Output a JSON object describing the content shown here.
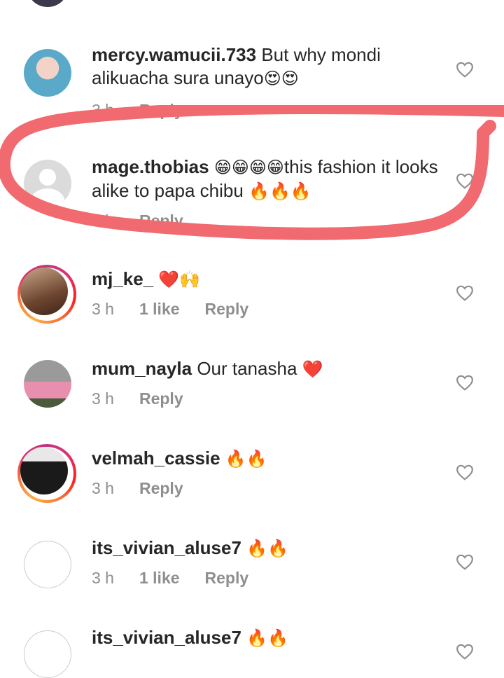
{
  "comments": [
    {
      "username": "mercy.wamucii.733",
      "text": "But why mondi alikuacha sura unayo",
      "emojis": "😍😍",
      "time": "3 h",
      "likes": "",
      "reply": "Reply"
    },
    {
      "username": "mage.thobias",
      "text_prefix": "😁😁😁😁",
      "text": "this fashion it looks alike to papa chibu",
      "emojis": "🔥🔥🔥",
      "time": "3 h",
      "likes": "",
      "reply": "Reply"
    },
    {
      "username": "mj_ke_",
      "text": "",
      "emojis": "❤️🙌",
      "time": "3 h",
      "likes": "1 like",
      "reply": "Reply"
    },
    {
      "username": "mum_nayla",
      "text": "Our tanasha",
      "emojis": "❤️",
      "time": "3 h",
      "likes": "",
      "reply": "Reply"
    },
    {
      "username": "velmah_cassie",
      "text": "",
      "emojis": "🔥🔥",
      "time": "3 h",
      "likes": "",
      "reply": "Reply"
    },
    {
      "username": "its_vivian_aluse7",
      "text": "",
      "emojis": "🔥🔥",
      "time": "3 h",
      "likes": "1 like",
      "reply": "Reply"
    },
    {
      "username": "its_vivian_aluse7",
      "text": "",
      "emojis": "🔥🔥",
      "time": "",
      "likes": "",
      "reply": ""
    }
  ],
  "colors": {
    "text": "#262626",
    "meta": "#8e8e8e",
    "highlight": "#f06a6f"
  },
  "icons": {
    "like": "heart-outline-icon",
    "default_avatar": "default-avatar-icon"
  }
}
